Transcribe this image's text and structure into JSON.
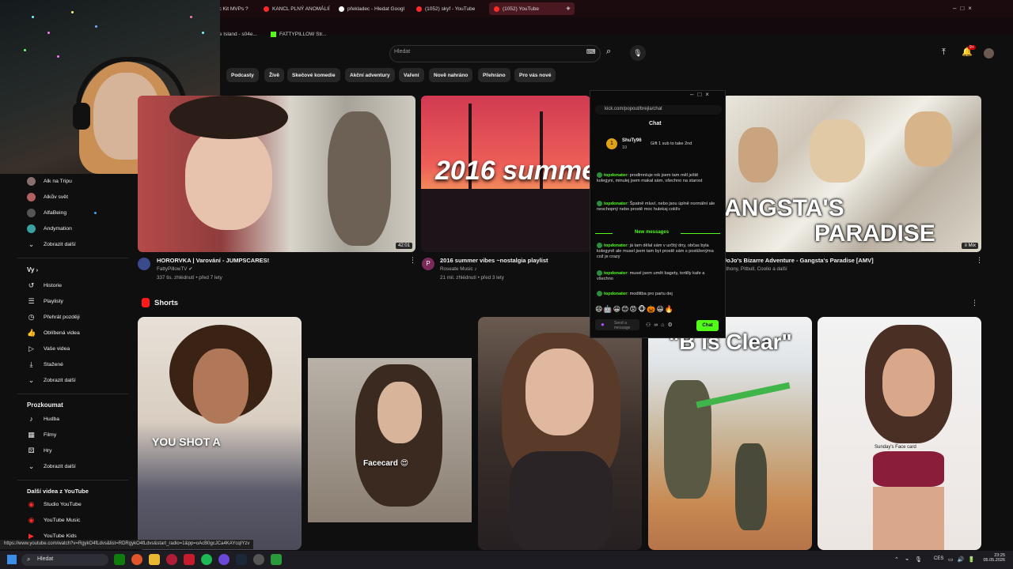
{
  "browser": {
    "tabs": [
      {
        "label": "ic Kit MVPs ?",
        "active": false
      },
      {
        "label": "KANCL PLNÝ ANOMÁLIÍ",
        "active": false
      },
      {
        "label": "překladec - Hledat Googl",
        "active": false
      },
      {
        "label": "(1052) skyf - YouTube",
        "active": false
      },
      {
        "label": "(1052) YouTube",
        "active": true
      }
    ],
    "new_tab": "+",
    "bookmarks": [
      "ove Island - s04e...",
      "FATTYPILLOW Str..."
    ]
  },
  "youtube": {
    "search_placeholder": "Hledat",
    "chips": [
      "Podcasty",
      "Živě",
      "Skečové komedie",
      "Akční adventury",
      "Vaření",
      "Nově nahráno",
      "Přehráno",
      "Pro vás nové"
    ],
    "sidebar": {
      "subs": [
        {
          "label": "Alk na Tripu",
          "color": "#8a6f6f"
        },
        {
          "label": "Alkův svět",
          "color": "#b06060"
        },
        {
          "label": "AlfaBeing",
          "color": "#555555"
        },
        {
          "label": "Andymation",
          "color": "#3aa0a0"
        }
      ],
      "subs_more": "Zobrazit další",
      "you_header": "Vy",
      "you_items": [
        {
          "label": "Historie",
          "icon": "history-icon",
          "glyph": "↺"
        },
        {
          "label": "Playlisty",
          "icon": "playlist-icon",
          "glyph": "☰"
        },
        {
          "label": "Přehrát později",
          "icon": "clock-icon",
          "glyph": "◷"
        },
        {
          "label": "Oblíbená videa",
          "icon": "thumbs-up-icon",
          "glyph": "👍"
        },
        {
          "label": "Vaše videa",
          "icon": "video-icon",
          "glyph": "▷"
        },
        {
          "label": "Stažené",
          "icon": "download-icon",
          "glyph": "⤓"
        }
      ],
      "you_more": "Zobrazit další",
      "explore_header": "Prozkoumat",
      "explore_items": [
        {
          "label": "Hudba",
          "icon": "music-icon",
          "glyph": "♪"
        },
        {
          "label": "Filmy",
          "icon": "film-icon",
          "glyph": "▦"
        },
        {
          "label": "Hry",
          "icon": "gamepad-icon",
          "glyph": "⚄"
        }
      ],
      "explore_more": "Zobrazit další",
      "more_header": "Další videa z YouTube",
      "more_items": [
        "Studio YouTube",
        "YouTube Music",
        "YouTube Kids"
      ]
    },
    "videos": [
      {
        "title": "HORORVKA | Varování - JUMPSCARES!",
        "channel": "FattyPillowTV",
        "meta": "337 tis. zhlédnutí • před 7 lety",
        "duration": "42:01"
      },
      {
        "title": "2016 summer vibes ~nostalgia playlist",
        "channel": "Roseate Music",
        "meta": "21 mil. zhlédnutí • před 3 lety",
        "overlay": "2016 summe"
      },
      {
        "title": "JoJo's Bizarre Adventure - Gangsta's Paradise [AMV]",
        "channel": "nthony, Pitbull, Coolio a další",
        "badge": "Mix",
        "overlay_top": "ANGSTA'S",
        "overlay_bottom": "PARADISE"
      }
    ],
    "shorts_header": "Shorts",
    "shorts": [
      {
        "caption": "YOU SHOT A"
      },
      {
        "caption": "Facecard 😍"
      },
      {
        "caption": ""
      },
      {
        "caption": "\"B is Clear\""
      },
      {
        "caption": "Sunday's Face card"
      }
    ],
    "status_url": "https://www.youtube.com/watch?v=RgykO4fLdvs&list=RDRgykO4fLdvs&start_radio=1&pp=oAcB0gcJCa4KAYcqIYzv"
  },
  "chat": {
    "url": "kick.com/popout/brejla/chat",
    "title": "Chat",
    "pinned_user": "ShuTy96",
    "pinned_count": "10",
    "pinned_text": "Gift 1 sub to take 2nd",
    "messages_before": [
      {
        "user": "topdonator",
        "text": "prodlmníuje rok jsem tam měl ještě kolegyni, minulej jsem makal sám, všechno na starost"
      },
      {
        "user": "topdonator",
        "text": "Špatně mluví, nebo jsou úplně normální ale neschopný nebo prostě moc hulekaj coklív"
      }
    ],
    "new_messages_label": "New messages",
    "messages_after": [
      {
        "user": "topdonator",
        "text": "já tam dělal sám v určitý dny, občas byla kolegyně ale musel jsem tam byt prostě sám s postiženýma což je crazy"
      },
      {
        "user": "topdonator",
        "text": "musel jsem umět bagety, tortilly kafe a všechno"
      },
      {
        "user": "topdonator",
        "text": "modlitba pro partu dej"
      }
    ],
    "send_placeholder": "Send a message",
    "send_button": "Chat"
  },
  "taskbar": {
    "search_label": "Hledat",
    "language": "CES",
    "time": "23:25",
    "date": "05.05.2026"
  }
}
